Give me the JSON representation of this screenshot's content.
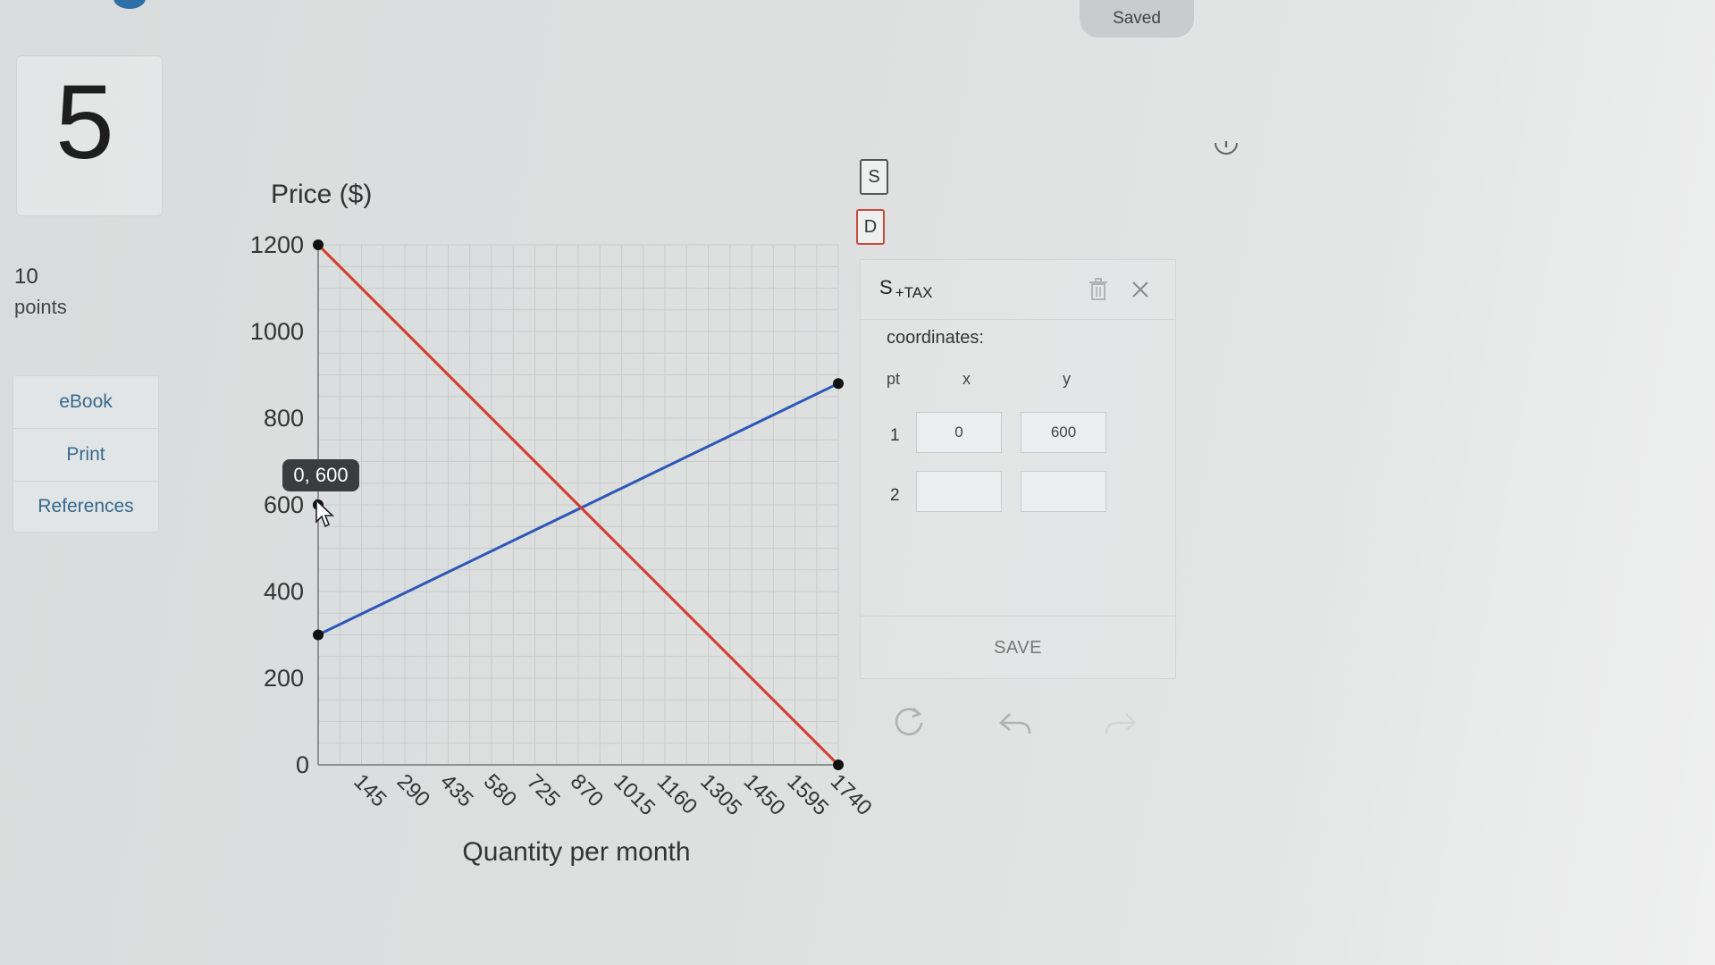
{
  "status": {
    "saved_label": "Saved"
  },
  "question": {
    "number": "5",
    "points_value": "10",
    "points_label": "points"
  },
  "sidebar": {
    "items": [
      {
        "label": "eBook"
      },
      {
        "label": "Print"
      },
      {
        "label": "References"
      }
    ]
  },
  "tools": {
    "supply_label": "S",
    "demand_label": "D"
  },
  "panel": {
    "title": "S",
    "title_sub": "+TAX",
    "coordinates_label": "coordinates:",
    "col_pt": "pt",
    "col_x": "x",
    "col_y": "y",
    "rows": [
      {
        "pt": "1",
        "x": "0",
        "y": "600"
      },
      {
        "pt": "2",
        "x": "",
        "y": ""
      }
    ],
    "save_label": "SAVE"
  },
  "tooltip": {
    "text": "0, 600"
  },
  "icons": [
    "info-icon",
    "trash-icon",
    "close-icon",
    "reset-icon",
    "undo-icon",
    "redo-icon",
    "cursor-icon"
  ],
  "colors": {
    "supply": "#2d57b8",
    "demand": "#d53a2a",
    "point": "#111111",
    "tooltip_bg": "#3a3d3f"
  },
  "chart_data": {
    "type": "line",
    "ylabel": "Price ($)",
    "xlabel": "Quantity per month",
    "x_ticks": [
      145,
      290,
      435,
      580,
      725,
      870,
      1015,
      1160,
      1305,
      1450,
      1595,
      1740
    ],
    "y_ticks": [
      0,
      200,
      400,
      600,
      800,
      1000,
      1200
    ],
    "xlim": [
      0,
      1740
    ],
    "ylim": [
      0,
      1200
    ],
    "grid": true,
    "series": [
      {
        "name": "S",
        "color": "#2d57b8",
        "points": [
          [
            0,
            300
          ],
          [
            1740,
            880
          ]
        ]
      },
      {
        "name": "D",
        "color": "#d53a2a",
        "points": [
          [
            0,
            1200
          ],
          [
            1740,
            0
          ]
        ]
      }
    ],
    "marked_points": [
      [
        0,
        600
      ]
    ]
  }
}
